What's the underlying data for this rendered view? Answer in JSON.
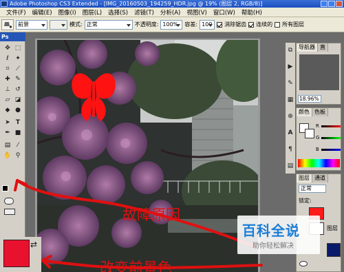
{
  "window": {
    "title": "Adobe Photoshop CS3 Extended - [IMG_20160503_194259_HDR.jpg @ 19% (图层 2, RGB/8)]"
  },
  "menu": [
    "文件(F)",
    "编辑(E)",
    "图像(I)",
    "图层(L)",
    "选择(S)",
    "滤镜(T)",
    "分析(A)",
    "视图(V)",
    "窗口(W)",
    "帮助(H)"
  ],
  "options": {
    "preset_value": "前景",
    "mode_label": "模式:",
    "mode_value": "正常",
    "opacity_label": "不透明度:",
    "opacity_value": "100%",
    "tolerance_label": "容差:",
    "tolerance_value": "100",
    "antialias_label": "消除锯齿",
    "antialias_checked": true,
    "contiguous_label": "连续的",
    "contiguous_checked": true,
    "all_layers_label": "所有图层",
    "all_layers_checked": false
  },
  "tools": {
    "header": "Ps"
  },
  "navigator": {
    "tabs": [
      "导航器",
      "直"
    ],
    "zoom": "18.96%"
  },
  "color_panel": {
    "tabs": [
      "颜色",
      "色板"
    ],
    "channels": [
      "R",
      "G",
      "B"
    ]
  },
  "layers_panel": {
    "tabs": [
      "图层",
      "通道"
    ],
    "blend_mode": "正常",
    "lock_label": "锁定:",
    "layer_name": "图层"
  },
  "annotations": {
    "fault_cause": "故障原因",
    "change_fg": "改变前景色"
  },
  "watermark": {
    "title": "百科全说",
    "subtitle": "助你轻松解决"
  },
  "colors": {
    "foreground": "#e8122e",
    "annotation": "#e01010",
    "butterfly": "#ff1212",
    "watermark_blue": "#1a7dd8"
  }
}
